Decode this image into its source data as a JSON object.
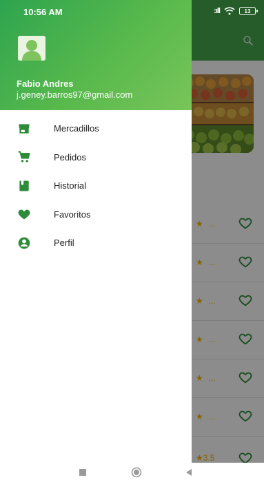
{
  "status_bar": {
    "time": "10:56 AM",
    "signal": ":ıll",
    "battery": "13"
  },
  "drawer": {
    "user": {
      "name": "Fabio Andres",
      "email": "j.geney.barros97@gmail.com"
    },
    "menu": [
      {
        "label": "Mercadillos",
        "icon": "store-icon"
      },
      {
        "label": "Pedidos",
        "icon": "cart-icon"
      },
      {
        "label": "Historial",
        "icon": "book-icon"
      },
      {
        "label": "Favoritos",
        "icon": "heart-icon"
      },
      {
        "label": "Perfil",
        "icon": "account-circle-icon"
      }
    ]
  },
  "background_list": {
    "rows": [
      {
        "rating": "★",
        "value": "..."
      },
      {
        "rating": "★",
        "value": "..."
      },
      {
        "rating": "★",
        "value": "..."
      },
      {
        "rating": "★",
        "value": "..."
      },
      {
        "rating": "★",
        "value": "..."
      },
      {
        "rating": "★",
        "value": "..."
      },
      {
        "rating": "★",
        "value": "3.5"
      }
    ]
  },
  "colors": {
    "primary": "#46a84b",
    "icon": "#2e8b3a",
    "rating": "#f2b705",
    "heart_outline": "#2e8b3a"
  }
}
